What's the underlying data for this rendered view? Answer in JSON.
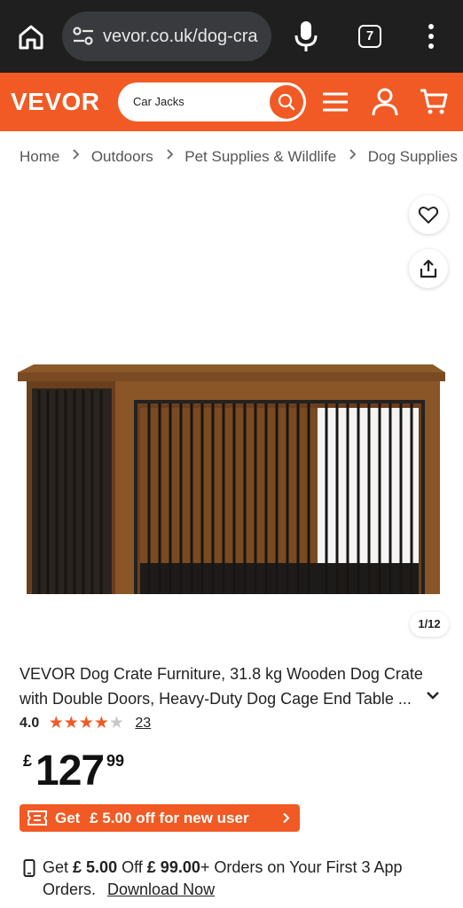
{
  "browser": {
    "url": "vevor.co.uk/dog-cra",
    "tab_count": "7"
  },
  "header": {
    "logo": "VEVOR",
    "search_value": "Car Jacks",
    "brand_color": "#f15a24"
  },
  "breadcrumb": [
    "Home",
    "Outdoors",
    "Pet Supplies & Wildlife",
    "Dog Supplies"
  ],
  "gallery": {
    "counter": "1/12"
  },
  "product": {
    "title": "VEVOR Dog Crate Furniture, 31.8 kg Wooden Dog Crate with Double Doors, Heavy-Duty Dog Cage End Table ...",
    "rating": "4.0",
    "rating_value": 4,
    "rating_max": 5,
    "review_count": "23",
    "price_currency": "£",
    "price_integer": "127",
    "price_decimal": "99"
  },
  "coupon": {
    "label": "Get",
    "amount": "£ 5.00",
    "suffix": "off for new user"
  },
  "app_offer": {
    "get": "Get",
    "amount": "£ 5.00",
    "off": "Off",
    "threshold": "£ 99.00",
    "rest": "+ Orders on Your First 3 App",
    "line2": "Orders.",
    "link": "Download Now"
  }
}
